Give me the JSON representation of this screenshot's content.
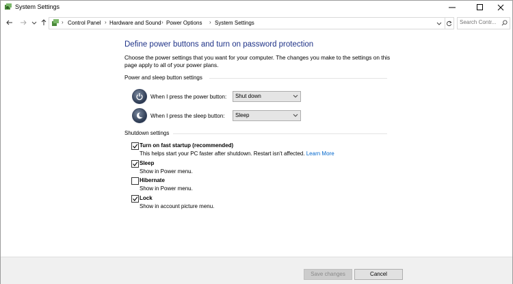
{
  "window": {
    "title": "System Settings"
  },
  "address": {
    "crumbs": [
      "Control Panel",
      "Hardware and Sound",
      "Power Options",
      "System Settings"
    ],
    "search_placeholder": "Search Contr..."
  },
  "main": {
    "title": "Define power buttons and turn on password protection",
    "description": "Choose the power settings that you want for your computer. The changes you make to the settings on this page apply to all of your power plans.",
    "power_section": {
      "heading": "Power and sleep button settings",
      "power_button_label": "When I press the power button:",
      "power_button_value": "Shut down",
      "sleep_button_label": "When I press the sleep button:",
      "sleep_button_value": "Sleep"
    },
    "shutdown_section": {
      "heading": "Shutdown settings",
      "options": [
        {
          "title": "Turn on fast startup (recommended)",
          "desc": "This helps start your PC faster after shutdown. Restart isn't affected.",
          "link": "Learn More",
          "checked": true
        },
        {
          "title": "Sleep",
          "desc": "Show in Power menu.",
          "checked": true
        },
        {
          "title": "Hibernate",
          "desc": "Show in Power menu.",
          "checked": false
        },
        {
          "title": "Lock",
          "desc": "Show in account picture menu.",
          "checked": true
        }
      ]
    }
  },
  "footer": {
    "save_label": "Save changes",
    "cancel_label": "Cancel"
  },
  "colors": {
    "title_blue": "#1e3287",
    "link_blue": "#0066cc"
  }
}
